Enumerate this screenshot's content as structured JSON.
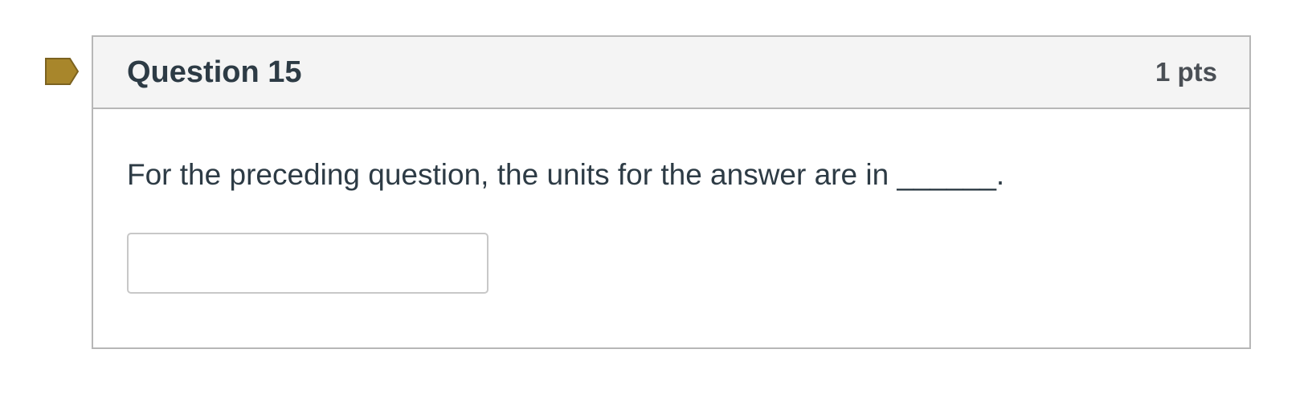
{
  "flag": {
    "icon": "bookmark-flag-icon",
    "color": "#a8862b",
    "border_color": "#7b6220"
  },
  "question": {
    "title": "Question 15",
    "points": "1 pts",
    "text": "For the preceding question, the units for the answer are in ______.",
    "answer": {
      "value": "",
      "placeholder": ""
    }
  }
}
